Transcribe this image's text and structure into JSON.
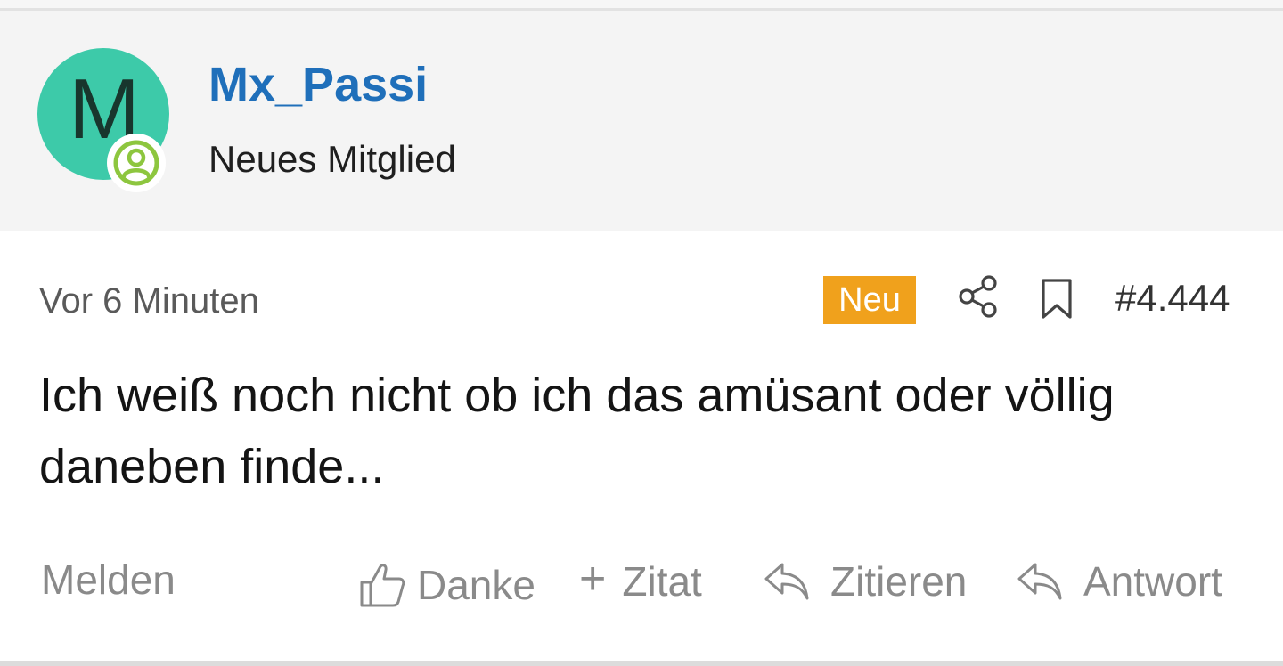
{
  "author": {
    "avatar_letter": "M",
    "avatar_color": "#3dcaa9",
    "name": "Mx_Passi",
    "name_color": "#1f6fba",
    "role": "Neues Mitglied",
    "status_icon": "online-user-icon",
    "status_color": "#8dc63f"
  },
  "post": {
    "time": "Vor 6 Minuten",
    "new_badge": "Neu",
    "new_badge_color": "#f0a11c",
    "number": "#4.444",
    "body": "Ich weiß noch nicht ob ich das amüsant oder völlig daneben finde...",
    "meta_icons": [
      "share-icon",
      "bookmark-icon"
    ]
  },
  "actions": {
    "report": "Melden",
    "thanks": "Danke",
    "plus_quote_symbol": "+",
    "plus_quote": "Zitat",
    "cite": "Zitieren",
    "answer": "Antwort",
    "icons": [
      "thumbs-up-icon",
      "plus-icon",
      "reply-icon",
      "reply-icon"
    ]
  }
}
